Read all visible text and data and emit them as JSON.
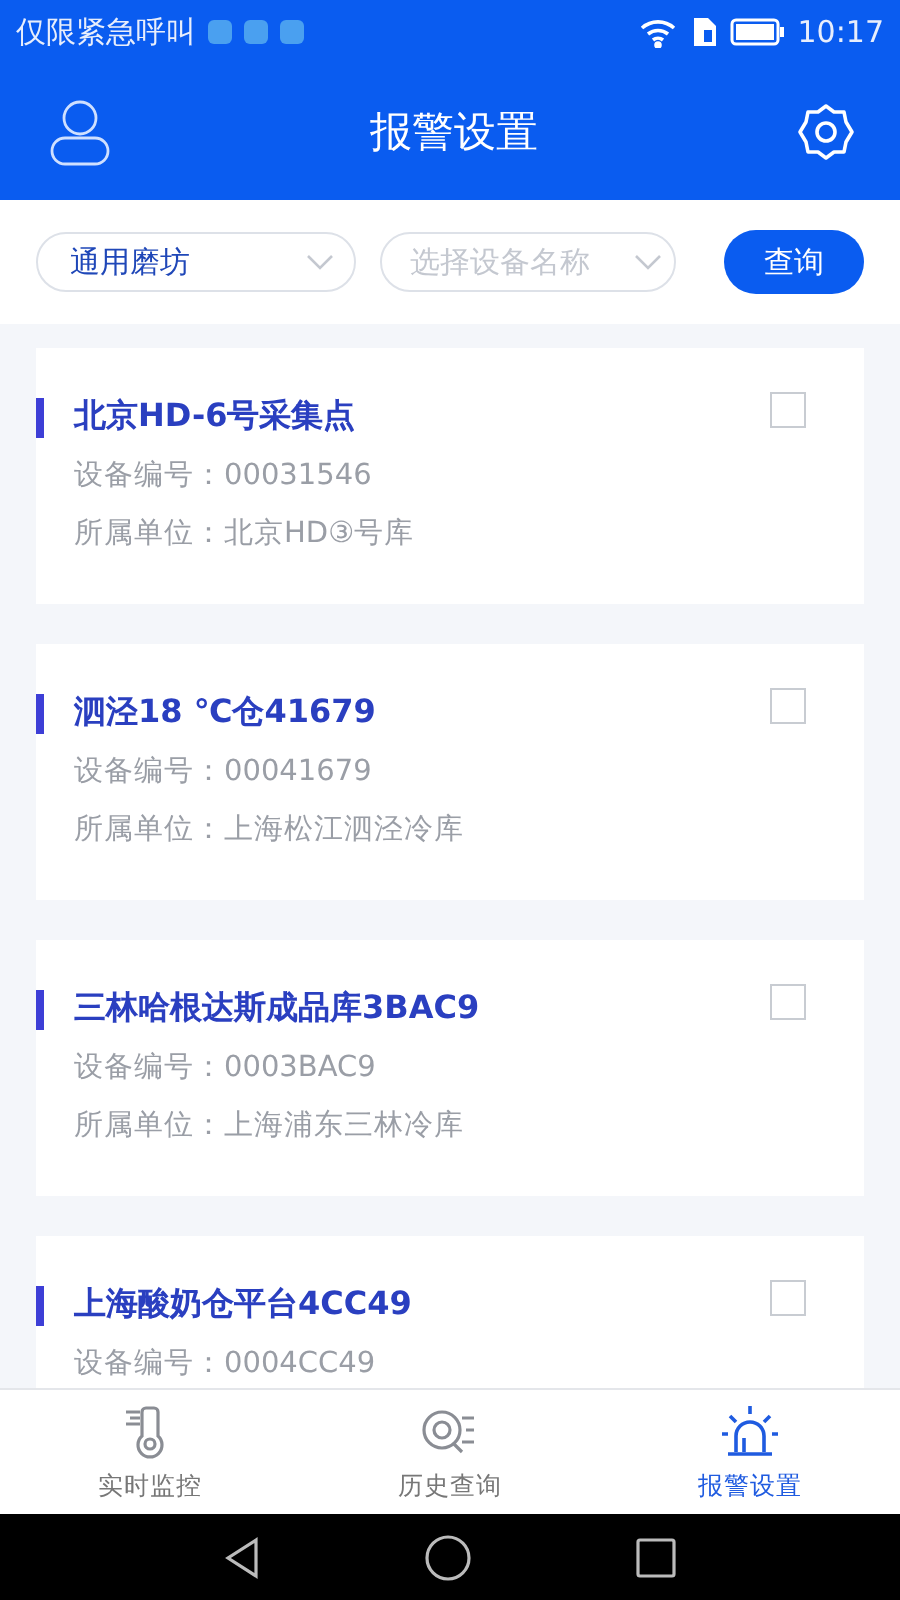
{
  "status_bar": {
    "carrier": "仅限紧急呼叫",
    "time": "10:17"
  },
  "header": {
    "title": "报警设置"
  },
  "filters": {
    "category": {
      "value": "通用磨坊"
    },
    "device": {
      "placeholder": "选择设备名称"
    },
    "button": "查询"
  },
  "devices": [
    {
      "name": "北京HD-6号采集点",
      "fields": [
        "设备编号：00031546",
        "所属单位：北京HD③号库"
      ],
      "checked": false
    },
    {
      "name": "泗泾18 ℃仓41679",
      "fields": [
        "设备编号：00041679",
        "所属单位：上海松江泗泾冷库"
      ],
      "checked": false
    },
    {
      "name": "三林哈根达斯成品库3BAC9",
      "fields": [
        "设备编号：0003BAC9",
        "所属单位：上海浦东三林冷库"
      ],
      "checked": false
    },
    {
      "name": "上海酸奶仓平台4CC49",
      "fields": [
        "设备编号：0004CC49"
      ],
      "checked": false
    }
  ],
  "tabs": [
    {
      "kind": "monitor",
      "label": "实时监控",
      "selected": false
    },
    {
      "kind": "history",
      "label": "历史查询",
      "selected": false
    },
    {
      "kind": "alarm",
      "label": "报警设置",
      "selected": true
    }
  ]
}
